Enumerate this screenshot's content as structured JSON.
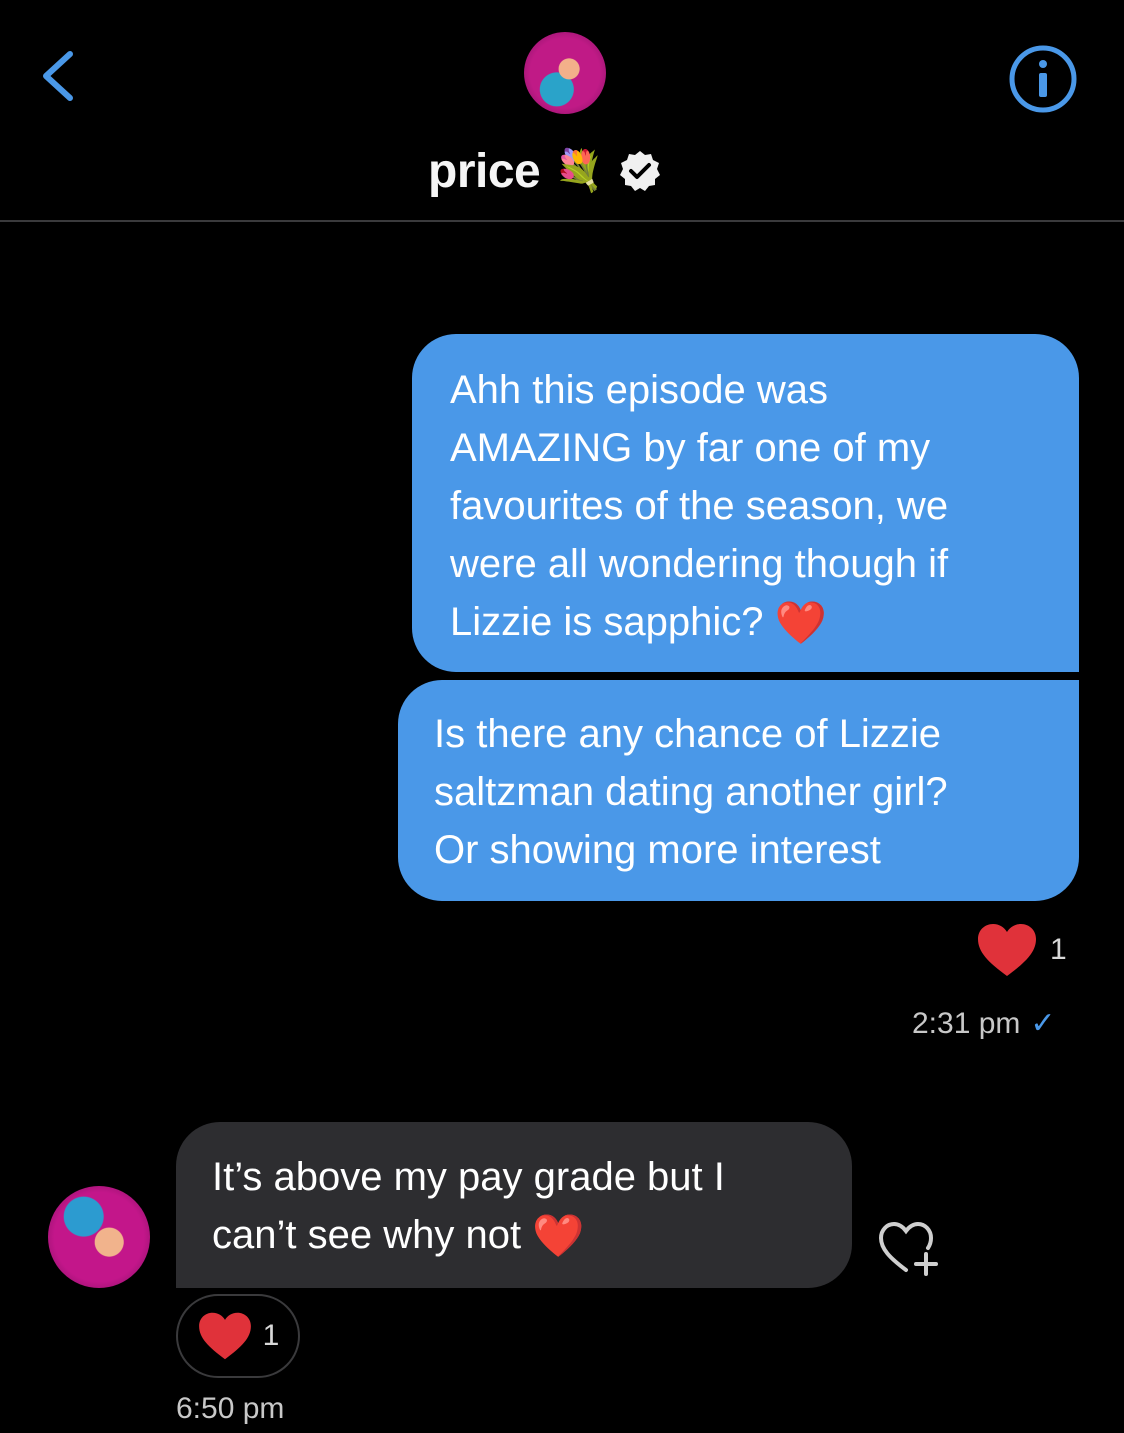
{
  "header": {
    "title": "price",
    "title_emoji": "💐",
    "verified_icon": "verified-badge-icon",
    "back_icon": "chevron-left-icon",
    "info_icon": "info-icon"
  },
  "messages": {
    "outgoing_1": "Ahh this episode was\nAMAZING by far one of my\nfavourites of the season, we\nwere all wondering though if\nLizzie is sapphic?",
    "outgoing_1_emoji": "❤️",
    "outgoing_2": "Is there any chance of Lizzie\nsaltzman dating another girl?\nOr showing more interest",
    "outgoing_reaction_count": "1",
    "outgoing_time": "2:31 pm",
    "outgoing_status_icon": "checkmark-icon",
    "incoming_1": "It’s above my pay grade but I\ncan’t see why not",
    "incoming_1_emoji": "❤️",
    "incoming_reaction_count": "1",
    "incoming_time": "6:50 pm",
    "add_reaction_icon": "heart-plus-icon"
  },
  "colors": {
    "background": "#000000",
    "outgoing_bubble": "#4a98e8",
    "incoming_bubble": "#2d2d30",
    "heart": "#e0323a",
    "accent": "#4a98e8"
  }
}
